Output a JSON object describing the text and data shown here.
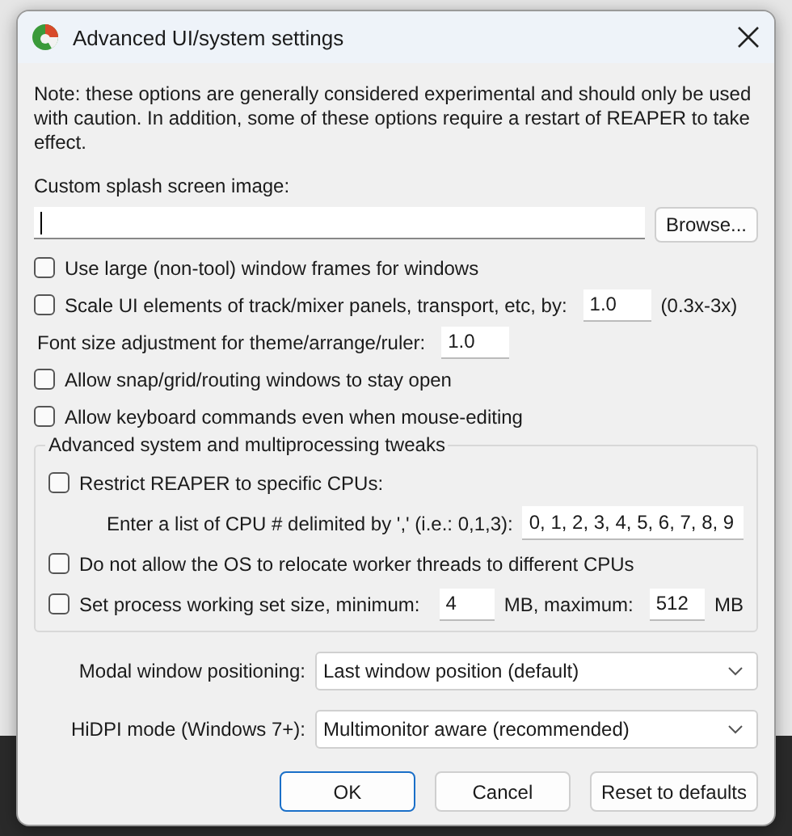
{
  "window": {
    "title": "Advanced UI/system settings"
  },
  "note": "Note: these options are generally considered experimental and should only be used with caution. In addition, some of these options require a restart of REAPER to take effect.",
  "splash": {
    "label": "Custom splash screen image:",
    "browse": "Browse..."
  },
  "options": [
    {
      "kind": "checkbox",
      "label": "Use large (non-tool) window frames for windows",
      "checked": false
    },
    {
      "kind": "checkbox_field",
      "label": "Scale UI elements of track/mixer panels, transport, etc, by:",
      "checked": false,
      "value": "1.0",
      "suffix": "(0.3x-3x)"
    },
    {
      "kind": "field",
      "label": "Font size adjustment for theme/arrange/ruler:",
      "value": "1.0"
    },
    {
      "kind": "checkbox",
      "label": "Allow snap/grid/routing windows to stay open",
      "checked": false
    },
    {
      "kind": "checkbox",
      "label": "Allow keyboard commands even when mouse-editing",
      "checked": false
    }
  ],
  "group": {
    "title": "Advanced system and multiprocessing tweaks",
    "items": [
      {
        "kind": "checkbox",
        "label": "Restrict REAPER to specific CPUs:",
        "checked": false
      },
      {
        "kind": "field",
        "label": "Enter a list of CPU # delimited by ',' (i.e.: 0,1,3):",
        "value": "0, 1, 2, 3, 4, 5, 6, 7, 8, 9"
      },
      {
        "kind": "checkbox",
        "label": "Do not allow the OS to relocate worker threads to different CPUs",
        "checked": false
      },
      {
        "kind": "range",
        "label": "Set process working set size, minimum:",
        "checked": false,
        "min": "4",
        "mid": "MB, maximum:",
        "max": "512",
        "unit": "MB"
      }
    ]
  },
  "selects": [
    {
      "label": "Modal window positioning:",
      "value": "Last window position (default)"
    },
    {
      "label": "HiDPI mode (Windows 7+):",
      "value": "Multimonitor aware (recommended)"
    }
  ],
  "buttons": [
    {
      "label": "OK",
      "default": true
    },
    {
      "label": "Cancel",
      "default": false
    },
    {
      "label": "Reset to defaults",
      "default": false
    }
  ]
}
